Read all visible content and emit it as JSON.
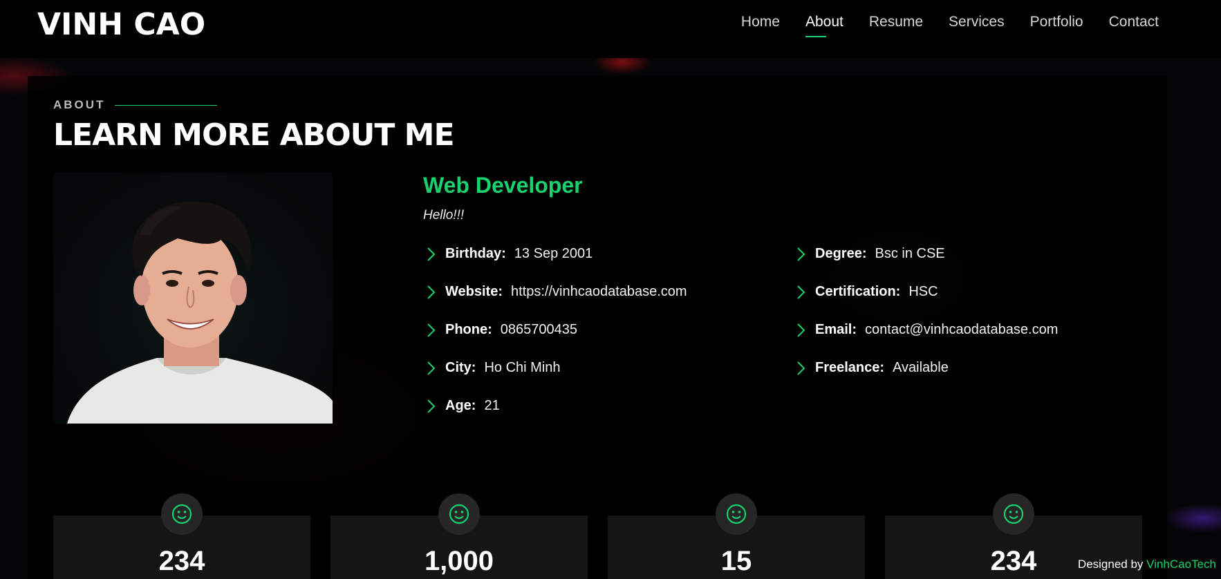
{
  "header": {
    "logo": "VINH CAO",
    "nav": [
      "Home",
      "About",
      "Resume",
      "Services",
      "Portfolio",
      "Contact"
    ],
    "active_nav": "About"
  },
  "about": {
    "label": "ABOUT",
    "title": "LEARN MORE ABOUT ME",
    "role": "Web Developer",
    "greeting": "Hello!!!",
    "left_info": [
      {
        "key": "Birthday:",
        "value": "13 Sep 2001"
      },
      {
        "key": "Website:",
        "value": "https://vinhcaodatabase.com"
      },
      {
        "key": "Phone:",
        "value": "0865700435"
      },
      {
        "key": "City:",
        "value": "Ho Chi Minh"
      },
      {
        "key": "Age:",
        "value": "21"
      }
    ],
    "right_info": [
      {
        "key": "Degree:",
        "value": "Bsc in CSE"
      },
      {
        "key": "Certification:",
        "value": "HSC"
      },
      {
        "key": "Email:",
        "value": "contact@vinhcaodatabase.com"
      },
      {
        "key": "Freelance:",
        "value": "Available"
      }
    ]
  },
  "counters": [
    {
      "icon": "smile-icon",
      "value": "234"
    },
    {
      "icon": "smile-icon",
      "value": "1,000"
    },
    {
      "icon": "smile-icon",
      "value": "15"
    },
    {
      "icon": "smile-icon",
      "value": "234"
    }
  ],
  "footer": {
    "credit_prefix": "Designed by",
    "credit_link": "VinhCaoTech"
  },
  "colors": {
    "accent": "#18d26e",
    "background": "#050507",
    "card": "#151515"
  }
}
